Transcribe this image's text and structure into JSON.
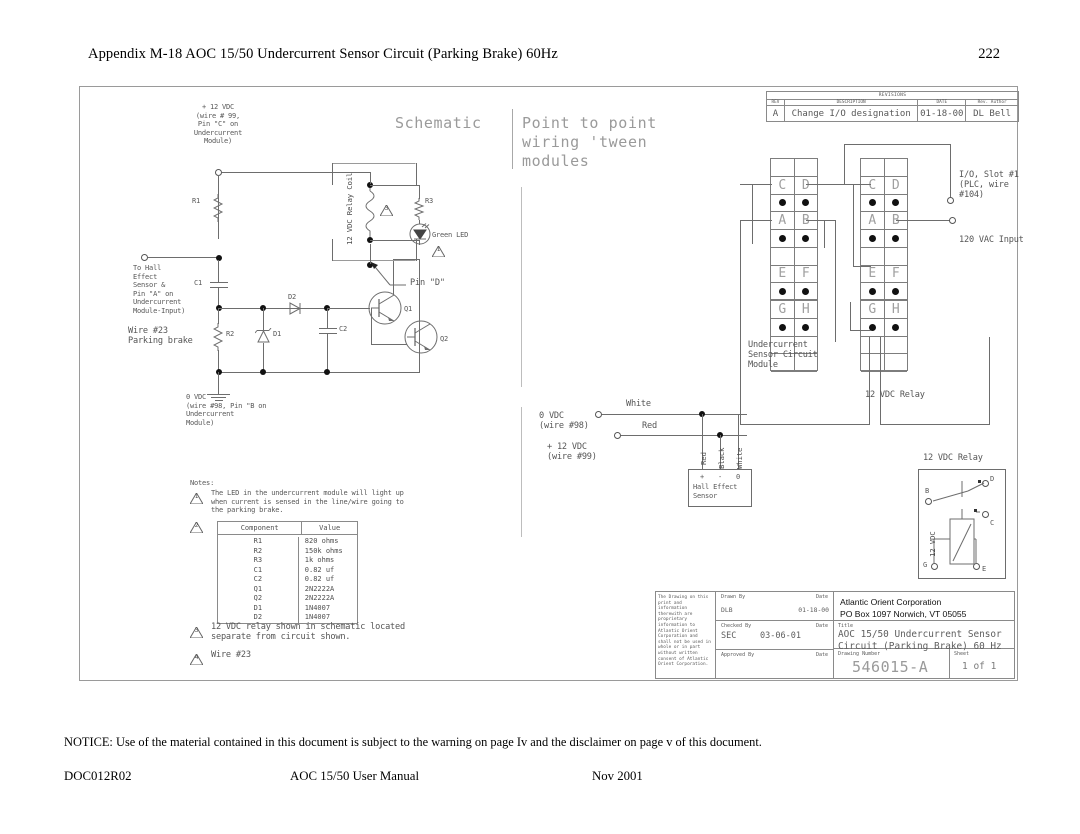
{
  "header": {
    "title": "Appendix M-18  AOC 15/50 Undercurrent Sensor Circuit (Parking Brake) 60Hz",
    "page_number": "222"
  },
  "drawing": {
    "section_titles": {
      "left": "Schematic",
      "right": "Point to point\nwiring 'tween\nmodules"
    },
    "schematic": {
      "supply_top": "+ 12 VDC\n(wire # 99,\nPin \"C\" on\nUndercurrent\nModule)",
      "supply_bottom": "0 VDC\n(wire #98, Pin \"B on\nUndercurrent\nModule)",
      "hall_input": "To Hall\nEffect\nSensor &\nPin \"A\" on\nUndercurrent\nModule-Input)",
      "wire_note": "Wire #23\nParking brake",
      "relay_coil_label": "12 VDC Relay Coil",
      "led_label": "Green LED",
      "pin_d_label": "Pin \"D\"",
      "components": {
        "r1": "R1",
        "r2": "R2",
        "r3": "R3",
        "c1": "C1",
        "c2": "C2",
        "q1": "Q1",
        "q2": "Q2",
        "d1": "D1",
        "d2": "D2"
      }
    },
    "notes": {
      "heading": "Notes:",
      "note1": "The LED in the undercurrent module will light up\nwhen current is sensed in the line/wire going to\nthe parking brake.",
      "note3": "12 VDC relay shown in schematic located\nseparate from circuit shown.",
      "note4": "Wire #23",
      "markers": [
        "1",
        "2",
        "3",
        "4"
      ],
      "table": {
        "columns": [
          "Component",
          "Value"
        ],
        "rows": [
          [
            "R1",
            "820 ohms"
          ],
          [
            "R2",
            "150k ohms"
          ],
          [
            "R3",
            "1k ohms"
          ],
          [
            "C1",
            "0.82 uf"
          ],
          [
            "C2",
            "0.82 uf"
          ],
          [
            "Q1",
            "2N2222A"
          ],
          [
            "Q2",
            "2N2222A"
          ],
          [
            "D1",
            "1N4007"
          ],
          [
            "D2",
            "1N4007"
          ]
        ]
      }
    },
    "pointtopoint": {
      "terminal_rows": [
        "C",
        "D",
        "A",
        "B",
        "E",
        "F",
        "G",
        "H"
      ],
      "io_slot_label": "I/O, Slot #1\n(PLC, wire\n#104)",
      "vac_input_label": "120 VAC Input",
      "module_label": "Undercurrent\nSensor Circuit\nModule",
      "relay_label_top": "12 VDC Relay",
      "relay_detail_title": "12 VDC Relay",
      "relay_detail_terminals": [
        "B",
        "D",
        "C",
        "G",
        "E"
      ],
      "relay_coil_text": "12 VDC",
      "zero_vdc": "0 VDC\n(wire #98)",
      "plus12_vdc": "+ 12 VDC\n(wire #99)",
      "wire_white": "White",
      "wire_red": "Red",
      "hall_sensor_label": "Hall Effect\nSensor",
      "hall_leads": [
        "Red",
        "Black",
        "White"
      ],
      "hall_pins": [
        "+",
        "-",
        "0"
      ]
    },
    "revisions": {
      "title": "REVISIONS",
      "columns": [
        "REV",
        "DESCRIPTION",
        "DATE",
        "Rev. Author"
      ],
      "rows": [
        [
          "A",
          "Change I/O designation",
          "01-18-00",
          "DL Bell"
        ]
      ]
    },
    "titleblock": {
      "proprietary": "The Drawing on this print and information therewith are proprietary information to Atlantic Orient Corporation and shall not be used in whole or in part without written consent of Atlantic Orient Corporation.",
      "drawn_by_label": "Drawn By",
      "drawn_by_date_label": "Date",
      "drawn_by": "DLB",
      "drawn_by_date": "01-18-00",
      "checked_by_label": "Checked By",
      "checked_by_date_label": "Date",
      "checked_by": "SEC",
      "checked_by_date": "03-06-01",
      "approved_by_label": "Approved By",
      "approved_by_date_label": "Date",
      "company": "Atlantic Orient Corporation",
      "address": "PO Box 1097 Norwich, VT 05055",
      "title_label": "Title",
      "title_value": "AOC 15/50 Undercurrent Sensor\nCircuit (Parking Brake) 60 Hz",
      "drawing_number_label": "Drawing Number",
      "drawing_number": "546015-A",
      "sheet_label": "Sheet",
      "sheet_value": "1 of 1"
    }
  },
  "footer": {
    "notice_keyword": "NOTICE:",
    "notice_text": "Use of the material contained in this document is subject to the warning on page Iv and the disclaimer on page v of this document.",
    "doc_id": "DOC012R02",
    "doc_title": "AOC 15/50 User Manual",
    "doc_date": "Nov 2001"
  }
}
